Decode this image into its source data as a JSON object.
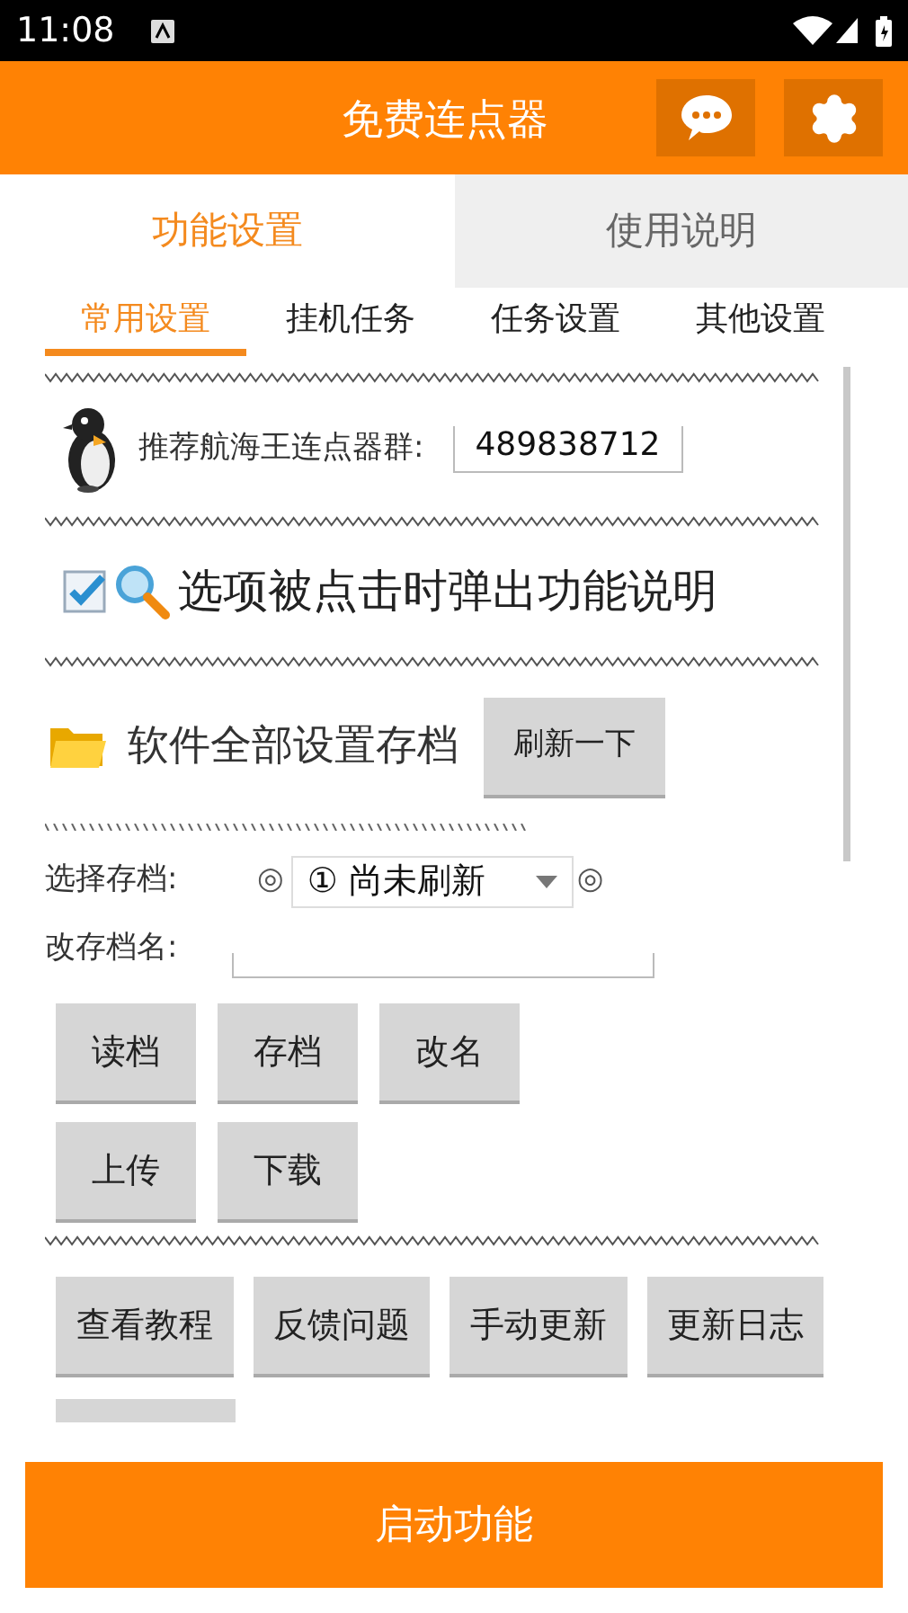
{
  "status_bar": {
    "time": "11:08"
  },
  "header": {
    "title": "免费连点器"
  },
  "tabs": [
    {
      "label": "功能设置",
      "selected": true
    },
    {
      "label": "使用说明",
      "selected": false
    }
  ],
  "subtabs": [
    {
      "label": "常用设置",
      "selected": true
    },
    {
      "label": "挂机任务",
      "selected": false
    },
    {
      "label": "任务设置",
      "selected": false
    },
    {
      "label": "其他设置",
      "selected": false
    }
  ],
  "group": {
    "label": "推荐航海王连点器群:",
    "value": "489838712"
  },
  "option": {
    "checked": true,
    "label": "选项被点击时弹出功能说明"
  },
  "archive": {
    "title": "软件全部设置存档",
    "refresh_button": "刷新一下",
    "select_label": "选择存档:",
    "prev_symbol": "◎",
    "select_value": "① 尚未刷新",
    "next_symbol": "◎",
    "rename_label": "改存档名:",
    "button_rows": [
      [
        "读档",
        "存档",
        "改名"
      ],
      [
        "上传",
        "下载"
      ]
    ]
  },
  "help_buttons": [
    "查看教程",
    "反馈问题",
    "手动更新",
    "更新日志"
  ],
  "start_button": "启动功能"
}
